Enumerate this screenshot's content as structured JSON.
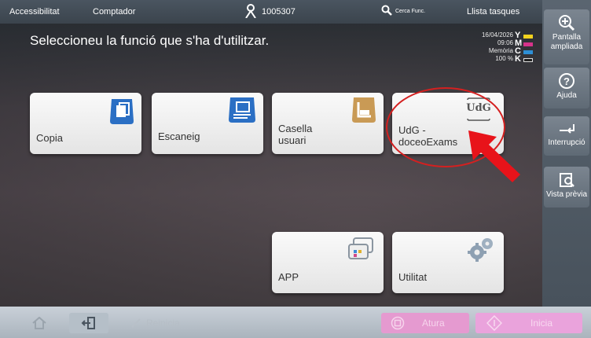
{
  "topbar": {
    "accessibility": "Accessibilitat",
    "counter": "Comptador",
    "user_id": "1005307",
    "search": "Cerca Func.",
    "job_list": "Llista tasques"
  },
  "main": {
    "title": "Seleccioneu la funció que s'ha d'utilitzar.",
    "status": {
      "date": "16/04/2026",
      "time": "09:06",
      "memory_label": "Memòria",
      "memory_value": "100 %",
      "toner": [
        {
          "label": "Y",
          "color": "#f2d21e"
        },
        {
          "label": "M",
          "color": "#d6338a"
        },
        {
          "label": "C",
          "color": "#2d8fd6"
        },
        {
          "label": "K",
          "color": "#222222"
        }
      ]
    },
    "tiles": {
      "copy": {
        "label": "Copia"
      },
      "scan": {
        "label": "Escaneig"
      },
      "user_box": {
        "line1": "Casella",
        "line2": "usuari"
      },
      "udg": {
        "line1": "UdG -",
        "line2": "doceoExams",
        "badge": "UdG"
      },
      "app": {
        "label": "APP"
      },
      "utility": {
        "label": "Utilitat"
      }
    }
  },
  "sidebar": {
    "zoom": {
      "line1": "Pantalla",
      "line2": "ampliada"
    },
    "help": "Ajuda",
    "interrupt": "Interrupció",
    "preview": "Vista prèvia"
  },
  "bottombar": {
    "reset": "Reinicia",
    "stop": "Atura",
    "start": "Inicia"
  },
  "colors": {
    "tile_icon_blue": "#2b6fc4",
    "tile_icon_brown": "#c99a55",
    "highlight_red": "#d42020",
    "stop_pink": "#e59ad0",
    "start_pink": "#eaa3dc"
  }
}
